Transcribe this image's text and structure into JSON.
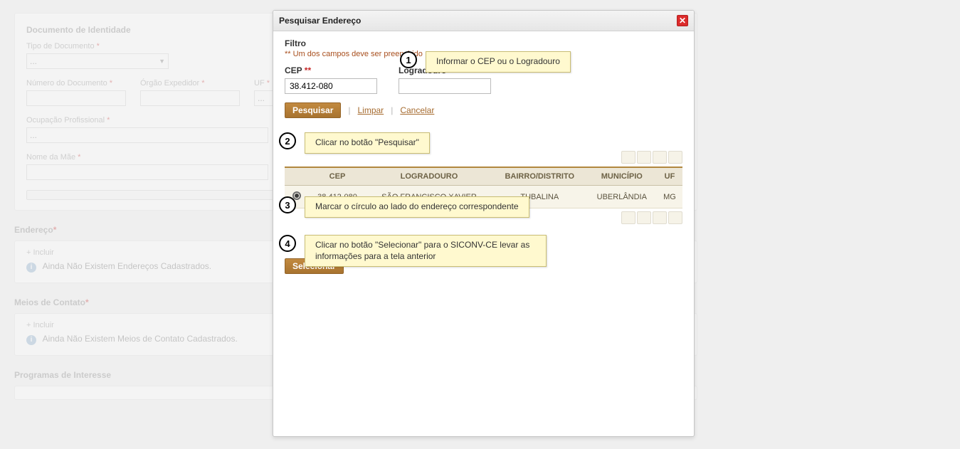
{
  "background": {
    "identity_section": "Documento de Identidade",
    "tipo_documento_label": "Tipo de Documento",
    "tipo_documento_value": "...",
    "numero_documento_label": "Número do Documento",
    "orgao_expedidor_label": "Órgão Expedidor",
    "uf_label": "UF ",
    "uf_value": "...",
    "ocupacao_label": "Ocupação Profissional",
    "ocupacao_value": "...",
    "nome_mae_label": "Nome da Mãe",
    "endereco_heading": "Endereço ",
    "incluir": "+ Incluir",
    "no_addr": "Ainda Não Existem Endereços Cadastrados.",
    "meios_heading": "Meios de Contato ",
    "no_meios": "Ainda Não Existem Meios de Contato Cadastrados.",
    "programas_heading": "Programas de Interesse"
  },
  "modal": {
    "title": "Pesquisar Endereço",
    "filtro": "Filtro",
    "must_fill": "** Um dos campos deve ser preenchido",
    "cep_label": "CEP ",
    "cep_value": "38.412-080",
    "logradouro_label": "Logradouro ",
    "pesquisar": "Pesquisar",
    "limpar": "Limpar",
    "cancelar": "Cancelar",
    "selecionar": "Selecionar",
    "cols": {
      "cep": "CEP",
      "logradouro": "LOGRADOURO",
      "bairro": "BAIRRO/DISTRITO",
      "municipio": "MUNICÍPIO",
      "uf": "UF"
    },
    "row": {
      "cep": "38.412-080",
      "logradouro": "SÃO FRANCISCO XAVIER",
      "bairro": "TUBALINA",
      "municipio": "UBERLÂNDIA",
      "uf": "MG"
    }
  },
  "callouts": {
    "n1": "1",
    "t1": "Informar o CEP ou o Logradouro",
    "n2": "2",
    "t2": "Clicar no botão \"Pesquisar\"",
    "n3": "3",
    "t3": "Marcar o círculo ao lado do endereço correspondente",
    "n4": "4",
    "t4": "Clicar no botão \"Selecionar\" para o SICONV-CE levar as informações para a tela anterior"
  }
}
